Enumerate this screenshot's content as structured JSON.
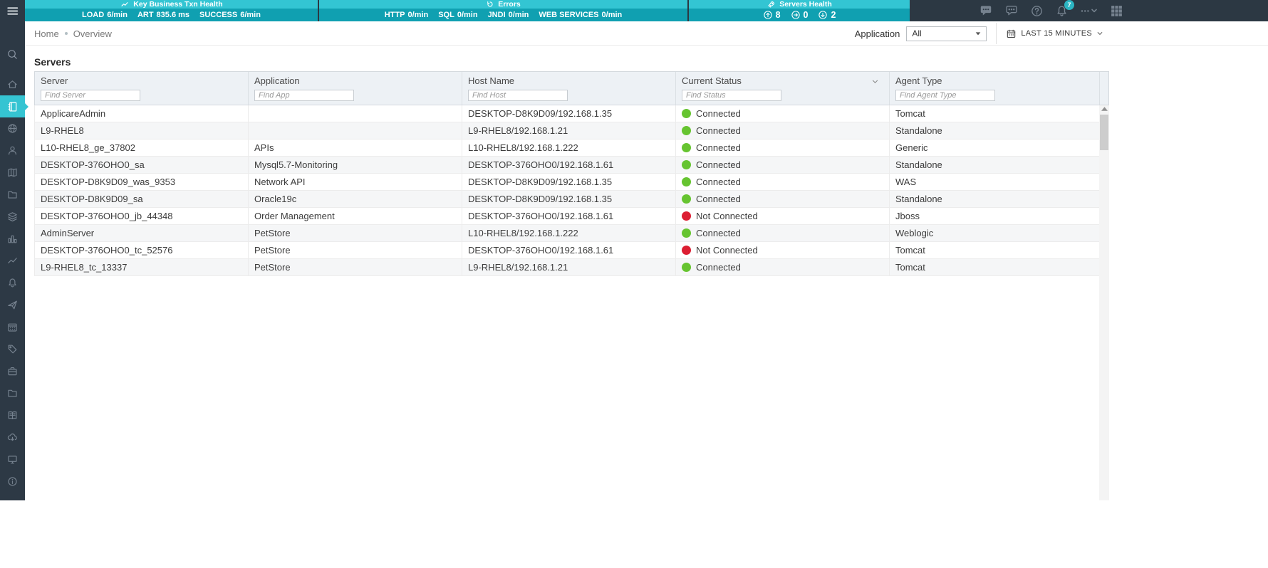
{
  "topbar": {
    "panels": [
      {
        "title": "Key Business Txn Health",
        "icon": "trend-icon",
        "metrics": [
          {
            "label": "LOAD",
            "value": "6/min"
          },
          {
            "label": "ART",
            "value": "835.6 ms"
          },
          {
            "label": "SUCCESS",
            "value": "6/min"
          }
        ]
      },
      {
        "title": "Errors",
        "icon": "refresh-icon",
        "metrics": [
          {
            "label": "HTTP",
            "value": "0/min"
          },
          {
            "label": "SQL",
            "value": "0/min"
          },
          {
            "label": "JNDI",
            "value": "0/min"
          },
          {
            "label": "WEB SERVICES",
            "value": "0/min"
          }
        ]
      },
      {
        "title": "Servers Health",
        "icon": "rocket-icon",
        "stats": [
          {
            "dir": "up",
            "value": "8"
          },
          {
            "dir": "right",
            "value": "0"
          },
          {
            "dir": "down",
            "value": "2"
          }
        ]
      }
    ],
    "right_icons": [
      "chat-filled-icon",
      "chat-outline-icon",
      "help-icon",
      "bell-icon",
      "more-icon",
      "apps-grid-icon"
    ],
    "notification_count": "7"
  },
  "breadcrumb": {
    "items": [
      "Home",
      "Overview"
    ]
  },
  "filters": {
    "application_label": "Application",
    "application_value": "All",
    "time_range_label": "LAST 15 MINUTES"
  },
  "servers": {
    "title": "Servers",
    "columns": [
      {
        "label": "Server",
        "placeholder": "Find Server"
      },
      {
        "label": "Application",
        "placeholder": "Find App"
      },
      {
        "label": "Host Name",
        "placeholder": "Find Host"
      },
      {
        "label": "Current Status",
        "placeholder": "Find Status",
        "sortable": true
      },
      {
        "label": "Agent Type",
        "placeholder": "Find Agent Type"
      }
    ],
    "rows": [
      {
        "server": "ApplicareAdmin",
        "application": "",
        "host": "DESKTOP-D8K9D09/192.168.1.35",
        "status": "Connected",
        "agent": "Tomcat"
      },
      {
        "server": "L9-RHEL8",
        "application": "",
        "host": "L9-RHEL8/192.168.1.21",
        "status": "Connected",
        "agent": "Standalone"
      },
      {
        "server": "L10-RHEL8_ge_37802",
        "application": "APIs",
        "host": "L10-RHEL8/192.168.1.222",
        "status": "Connected",
        "agent": "Generic"
      },
      {
        "server": "DESKTOP-376OHO0_sa",
        "application": "Mysql5.7-Monitoring",
        "host": "DESKTOP-376OHO0/192.168.1.61",
        "status": "Connected",
        "agent": "Standalone"
      },
      {
        "server": "DESKTOP-D8K9D09_was_9353",
        "application": "Network API",
        "host": "DESKTOP-D8K9D09/192.168.1.35",
        "status": "Connected",
        "agent": "WAS"
      },
      {
        "server": "DESKTOP-D8K9D09_sa",
        "application": "Oracle19c",
        "host": "DESKTOP-D8K9D09/192.168.1.35",
        "status": "Connected",
        "agent": "Standalone"
      },
      {
        "server": "DESKTOP-376OHO0_jb_44348",
        "application": "Order Management",
        "host": "DESKTOP-376OHO0/192.168.1.61",
        "status": "Not Connected",
        "agent": "Jboss"
      },
      {
        "server": "AdminServer",
        "application": "PetStore",
        "host": "L10-RHEL8/192.168.1.222",
        "status": "Connected",
        "agent": "Weblogic"
      },
      {
        "server": "DESKTOP-376OHO0_tc_52576",
        "application": "PetStore",
        "host": "DESKTOP-376OHO0/192.168.1.61",
        "status": "Not Connected",
        "agent": "Tomcat"
      },
      {
        "server": "L9-RHEL8_tc_13337",
        "application": "PetStore",
        "host": "L9-RHEL8/192.168.1.21",
        "status": "Connected",
        "agent": "Tomcat"
      }
    ]
  },
  "sidebar": {
    "search": {
      "name": "search",
      "icon": "search-icon"
    },
    "items": [
      {
        "name": "home",
        "icon": "home-icon"
      },
      {
        "name": "servers",
        "icon": "notebook-icon",
        "active": true
      },
      {
        "name": "applications",
        "icon": "globe-icon"
      },
      {
        "name": "users",
        "icon": "user-icon"
      },
      {
        "name": "transactions",
        "icon": "map-icon"
      },
      {
        "name": "repository",
        "icon": "folder-icon"
      },
      {
        "name": "integrations",
        "icon": "layers-icon"
      },
      {
        "name": "reports",
        "icon": "bar-chart-icon"
      },
      {
        "name": "analytics",
        "icon": "trend-icon"
      },
      {
        "name": "alerts",
        "icon": "bell-icon"
      },
      {
        "name": "notifications",
        "icon": "send-icon"
      },
      {
        "name": "schedules",
        "icon": "calendar-icon"
      },
      {
        "name": "tags",
        "icon": "tag-icon"
      },
      {
        "name": "toolbox",
        "icon": "briefcase-icon"
      },
      {
        "name": "files",
        "icon": "folder-icon"
      },
      {
        "name": "logs",
        "icon": "book-icon"
      },
      {
        "name": "cloud",
        "icon": "cloud-download-icon"
      },
      {
        "name": "consoles",
        "icon": "monitor-icon"
      },
      {
        "name": "about",
        "icon": "info-icon"
      }
    ]
  },
  "colors": {
    "teal": "#33c5d3",
    "teal_dark": "#10a0b1",
    "green": "#66c430",
    "red": "#dc1e32",
    "sidebar_bg": "#2d3945"
  }
}
